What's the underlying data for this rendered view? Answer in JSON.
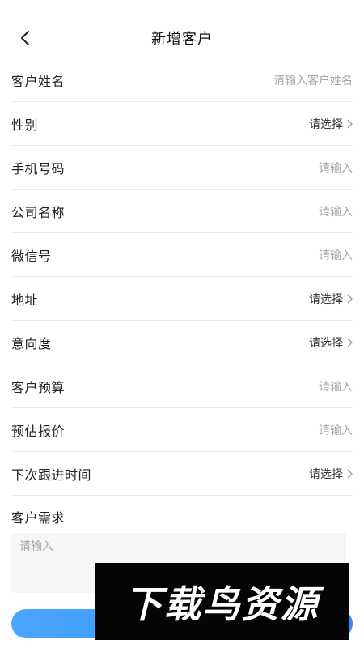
{
  "header": {
    "title": "新增客户",
    "back_icon": "chevron-left-icon"
  },
  "fields": [
    {
      "label": "客户姓名",
      "value": "请输入客户姓名",
      "type": "input"
    },
    {
      "label": "性别",
      "value": "请选择",
      "type": "select"
    },
    {
      "label": "手机号码",
      "value": "请输入",
      "type": "input"
    },
    {
      "label": "公司名称",
      "value": "请输入",
      "type": "input"
    },
    {
      "label": "微信号",
      "value": "请输入",
      "type": "input"
    },
    {
      "label": "地址",
      "value": "请选择",
      "type": "select"
    },
    {
      "label": "意向度",
      "value": "请选择",
      "type": "select"
    },
    {
      "label": "客户预算",
      "value": "请输入",
      "type": "input"
    },
    {
      "label": "预估报价",
      "value": "请输入",
      "type": "input"
    },
    {
      "label": "下次跟进时间",
      "value": "请选择",
      "type": "select"
    }
  ],
  "needs": {
    "label": "客户需求",
    "placeholder": "请输入"
  },
  "watermark": {
    "text": "下载鸟资源"
  },
  "colors": {
    "accent": "#2e8cf5",
    "placeholder": "#a6a6a6",
    "divider": "#ececec"
  }
}
